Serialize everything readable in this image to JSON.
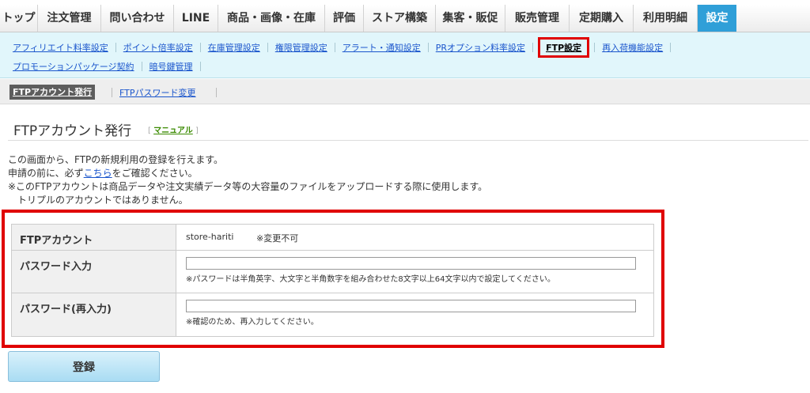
{
  "main_nav": {
    "tabs": [
      {
        "label": "トップ",
        "active": false
      },
      {
        "label": "注文管理",
        "active": false
      },
      {
        "label": "問い合わせ",
        "active": false
      },
      {
        "label": "LINE",
        "active": false
      },
      {
        "label": "商品・画像・在庫",
        "active": false
      },
      {
        "label": "評価",
        "active": false
      },
      {
        "label": "ストア構築",
        "active": false
      },
      {
        "label": "集客・販促",
        "active": false
      },
      {
        "label": "販売管理",
        "active": false
      },
      {
        "label": "定期購入",
        "active": false
      },
      {
        "label": "利用明細",
        "active": false
      },
      {
        "label": "設定",
        "active": true
      }
    ]
  },
  "sub_nav": {
    "row1": [
      "アフィリエイト料率設定",
      "ポイント倍率設定",
      "在庫管理設定",
      "権限管理設定",
      "アラート・通知設定",
      "PRオプション料率設定",
      "FTP設定",
      "再入荷機能設定"
    ],
    "row2": [
      "プロモーションパッケージ契約",
      "暗号鍵管理"
    ],
    "active": "FTP設定"
  },
  "tertiary_nav": {
    "active": "FTPアカウント発行",
    "link": "FTPパスワード変更"
  },
  "page": {
    "title": "FTPアカウント発行",
    "manual_open": "[",
    "manual_label": "マニュアル",
    "manual_close": "]"
  },
  "description": {
    "line1": "この画面から、FTPの新規利用の登録を行えます。",
    "line2_pre": "申請の前に、必ず",
    "line2_link": "こちら",
    "line2_post": "をご確認ください。",
    "line3": "※このFTPアカウントは商品データや注文実績データ等の大容量のファイルをアップロードする際に使用します。",
    "line4": "トリプルのアカウントではありません。"
  },
  "form": {
    "account_label": "FTPアカウント",
    "account_value": "store-hariti",
    "account_note": "※変更不可",
    "password_label": "パスワード入力",
    "password_value": "",
    "password_hint": "※パスワードは半角英字、大文字と半角数字を組み合わせた8文字以上64文字以内で設定してください。",
    "confirm_label": "パスワード(再入力)",
    "confirm_value": "",
    "confirm_hint": "※確認のため、再入力してください。"
  },
  "submit_label": "登録",
  "colors": {
    "active_tab": "#2f9fd8",
    "highlight_border": "#e00000",
    "subnav_bg": "#e1f6fb",
    "link": "#1a55cc"
  }
}
